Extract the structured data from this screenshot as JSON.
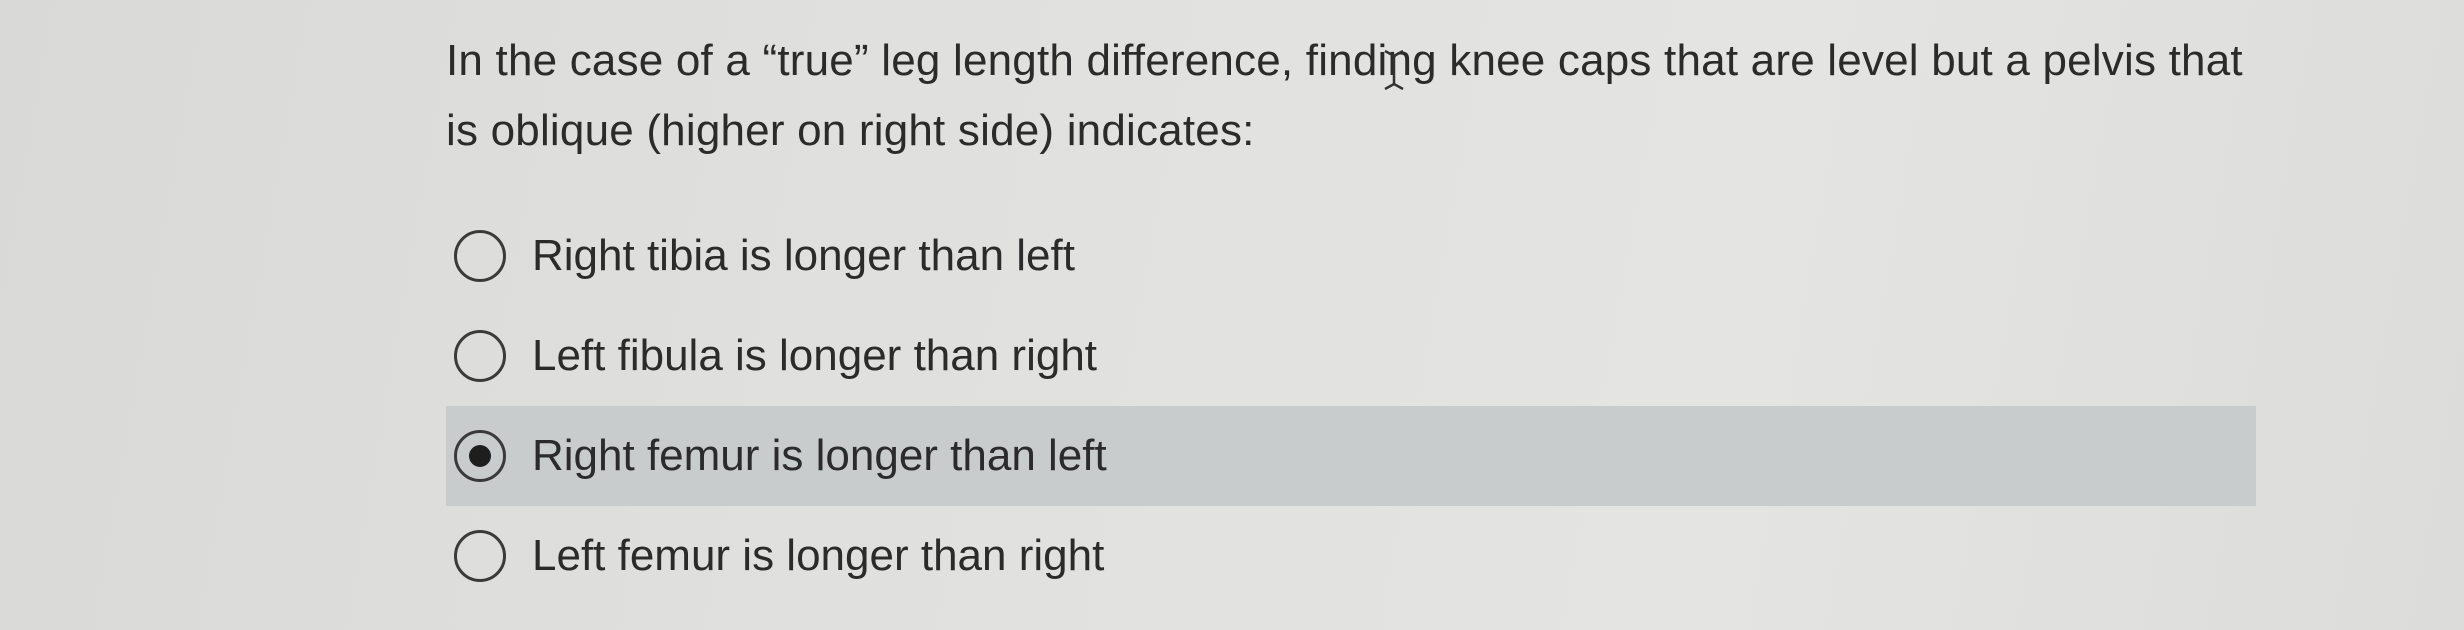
{
  "question": {
    "text": "In the case of a “true” leg length difference, finding knee caps that are level but a pelvis that is oblique (higher on right side) indicates:"
  },
  "options": [
    {
      "label": "Right tibia is longer than left",
      "selected": false
    },
    {
      "label": "Left fibula is longer than right",
      "selected": false
    },
    {
      "label": "Right femur is longer than left",
      "selected": true
    },
    {
      "label": "Left femur is longer than right",
      "selected": false
    }
  ],
  "colors": {
    "background": "#e0e0de",
    "selected_row": "#c9cccc",
    "text": "#2b2b2b"
  },
  "icons": [
    "text-cursor-icon",
    "radio-empty-icon",
    "radio-selected-icon"
  ]
}
